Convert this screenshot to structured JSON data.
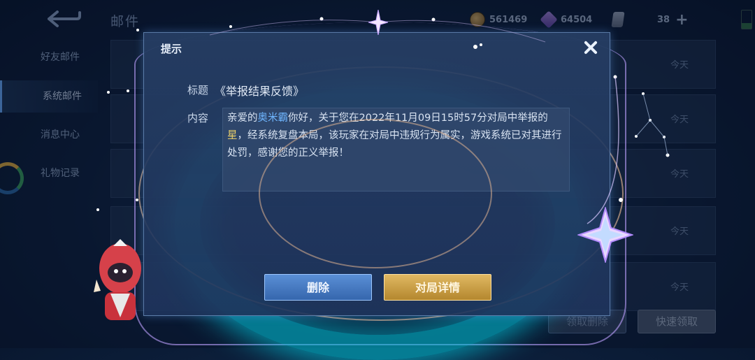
{
  "topbar": {
    "mail_title": "邮件",
    "gold_amount": "561469",
    "diamond_amount": "64504",
    "voucher_amount": "38"
  },
  "sidebar": {
    "items": [
      {
        "label": "好友邮件"
      },
      {
        "label": "系统邮件"
      },
      {
        "label": "消息中心"
      },
      {
        "label": "礼物记录"
      }
    ]
  },
  "mail_list": {
    "dates": [
      "今天",
      "今天",
      "今天",
      "今天",
      "今天"
    ],
    "receive_delete_label": "领取删除",
    "quick_receive_label": "快速领取"
  },
  "dialog": {
    "title": "提示",
    "subject_label": "标题",
    "subject_value": "《举报结果反馈》",
    "content_label": "内容",
    "content": {
      "part1": "亲爱的",
      "player_name": "奥米霸",
      "part2": "你好，关于您在2022年11月09日15时57分对局中举报的",
      "reported_name": "星",
      "part3": "，经系统复盘本局，该玩家在对局中违规行为属实，游戏系统已对其进行处罚，感谢您的正义举报！"
    },
    "delete_label": "删除",
    "details_label": "对局详情"
  },
  "icons": [
    "back-arrow-icon",
    "gold-coin-icon",
    "diamond-icon",
    "voucher-icon",
    "plus-icon",
    "close-icon",
    "crystal-star-icon"
  ],
  "colors": {
    "accent_blue": "#6fb6ff",
    "accent_gold": "#e9cf6a",
    "delete_button": "#3566ad",
    "details_button": "#b4872e"
  }
}
